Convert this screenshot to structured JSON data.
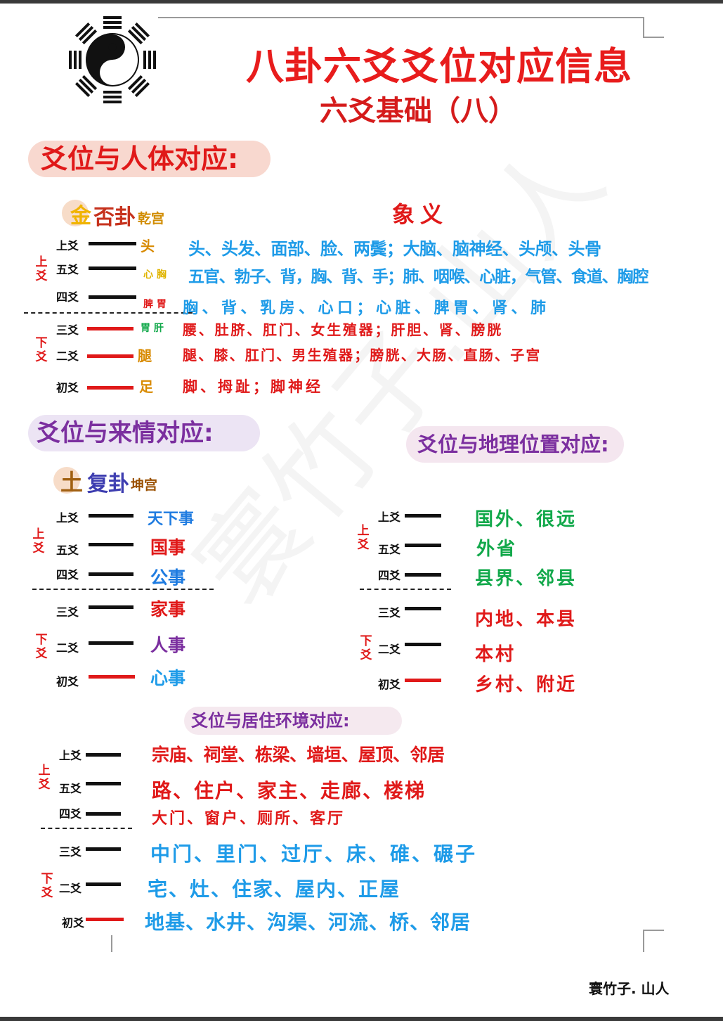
{
  "title": "八卦六爻爻位对应信息",
  "subtitle": "六爻基础（八）",
  "section1": {
    "heading": "爻位与人体对应:",
    "gua_element": "金",
    "gua_name": "否卦",
    "gua_palace": "乾宫",
    "meaning_heading": "象义",
    "group_upper": "上爻",
    "group_lower": "下爻",
    "rows": [
      {
        "yao": "上爻",
        "mark": "头",
        "text": "头、头发、面部、脸、两鬓；大脑、脑神经、头颅、头骨"
      },
      {
        "yao": "五爻",
        "mark": "心 胸",
        "text": "五官、勃子、背，胸、背、手；肺、咽喉、心脏，气管、食道、胸腔"
      },
      {
        "yao": "四爻",
        "mark": "脾 胃",
        "text": "胸、背、乳房、心口；心脏、脾胃、肾、肺"
      },
      {
        "yao": "三爻",
        "mark": "胃 肝",
        "text": "腰、肚脐、肛门、女生殖器；肝胆、肾、膀胱"
      },
      {
        "yao": "二爻",
        "mark": "腿",
        "text": "腿、膝、肛门、男生殖器；膀胱、大肠、直肠、子宫"
      },
      {
        "yao": "初爻",
        "mark": "足",
        "text": "脚、拇趾；脚神经"
      }
    ]
  },
  "section2": {
    "heading": "爻位与来情对应:",
    "gua_element": "土",
    "gua_name": "复卦",
    "gua_palace": "坤宫",
    "group_upper": "上爻",
    "group_lower": "下爻",
    "rows": [
      {
        "yao": "上爻",
        "text": "天下事"
      },
      {
        "yao": "五爻",
        "text": "国事"
      },
      {
        "yao": "四爻",
        "text": "公事"
      },
      {
        "yao": "三爻",
        "text": "家事"
      },
      {
        "yao": "二爻",
        "text": "人事"
      },
      {
        "yao": "初爻",
        "text": "心事"
      }
    ]
  },
  "section3": {
    "heading": "爻位与地理位置对应:",
    "group_upper": "上爻",
    "group_lower": "下爻",
    "rows": [
      {
        "yao": "上爻",
        "text": "国外、很远"
      },
      {
        "yao": "五爻",
        "text": "外省"
      },
      {
        "yao": "四爻",
        "text": "县界、邻县"
      },
      {
        "yao": "三爻",
        "text": "内地、本县"
      },
      {
        "yao": "二爻",
        "text": "本村"
      },
      {
        "yao": "初爻",
        "text": "乡村、附近"
      }
    ]
  },
  "section4": {
    "heading": "爻位与居住环境对应:",
    "group_upper": "上爻",
    "group_lower": "下爻",
    "rows": [
      {
        "yao": "上爻",
        "text": "宗庙、祠堂、栋梁、墙垣、屋顶、邻居"
      },
      {
        "yao": "五爻",
        "text": "路、住户、家主、走廊、楼梯"
      },
      {
        "yao": "四爻",
        "text": "大门、窗户、厕所、客厅"
      },
      {
        "yao": "三爻",
        "text": "中门、里门、过厅、床、碓、碾子"
      },
      {
        "yao": "二爻",
        "text": "宅、灶、住家、屋内、正屋"
      },
      {
        "yao": "初爻",
        "text": "地基、水井、沟渠、河流、桥、邻居"
      }
    ]
  },
  "watermark": "寰竹子.山人",
  "signature": "寰竹子. 山人",
  "colors": {
    "red": "#e01919",
    "blue": "#1e9be8",
    "purple": "#7b2f9f",
    "green": "#11a84a",
    "yellow": "#e0b400",
    "black": "#111111"
  },
  "icons": [
    "bagua-taiji-icon"
  ]
}
